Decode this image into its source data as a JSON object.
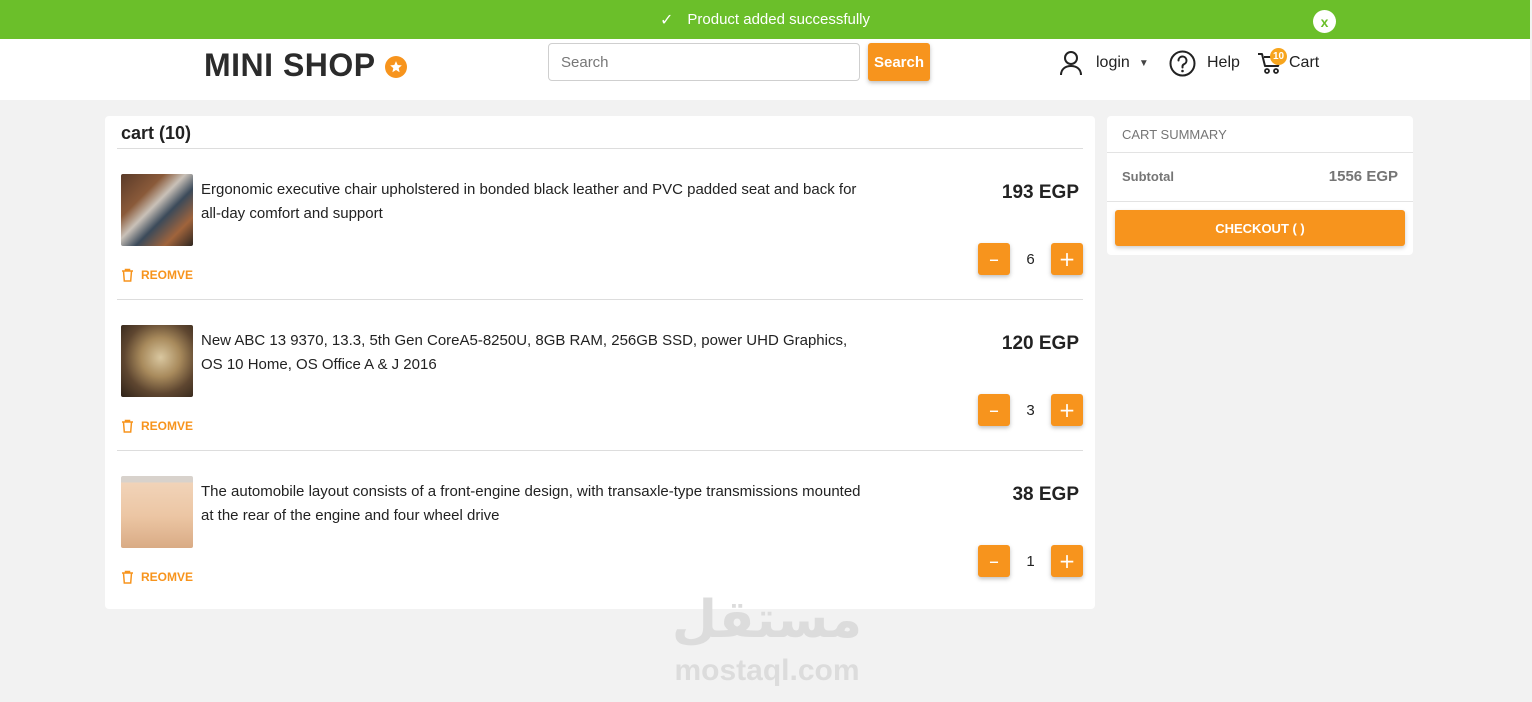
{
  "toast": {
    "message": "Product added successfully",
    "close": "x"
  },
  "header": {
    "logo": "MINI SHOP",
    "search_placeholder": "Search",
    "search_button": "Search",
    "login": "login",
    "help": "Help",
    "cart": "Cart",
    "cart_count": "10"
  },
  "cart": {
    "title": "cart (10)",
    "items": [
      {
        "description": "Ergonomic executive chair upholstered in bonded black leather and PVC padded seat and back for all-day comfort and support",
        "price": "193 EGP",
        "quantity": "6",
        "remove": "REOMVE"
      },
      {
        "description": "New ABC 13 9370, 13.3, 5th Gen CoreA5-8250U, 8GB RAM, 256GB SSD, power UHD Graphics, OS 10 Home, OS Office A & J 2016",
        "price": "120 EGP",
        "quantity": "3",
        "remove": "REOMVE"
      },
      {
        "description": "The automobile layout consists of a front-engine design, with transaxle-type transmissions mounted at the rear of the engine and four wheel drive",
        "price": "38 EGP",
        "quantity": "1",
        "remove": "REOMVE"
      }
    ]
  },
  "summary": {
    "title": "CART SUMMARY",
    "subtotal_label": "Subtotal",
    "subtotal_value": "1556 EGP",
    "checkout": "CHECKOUT ( )"
  },
  "watermark": {
    "arabic": "مستقل",
    "latin": "mostaql.com"
  },
  "colors": {
    "accent": "#f7941d",
    "toast": "#6bbf2a"
  }
}
